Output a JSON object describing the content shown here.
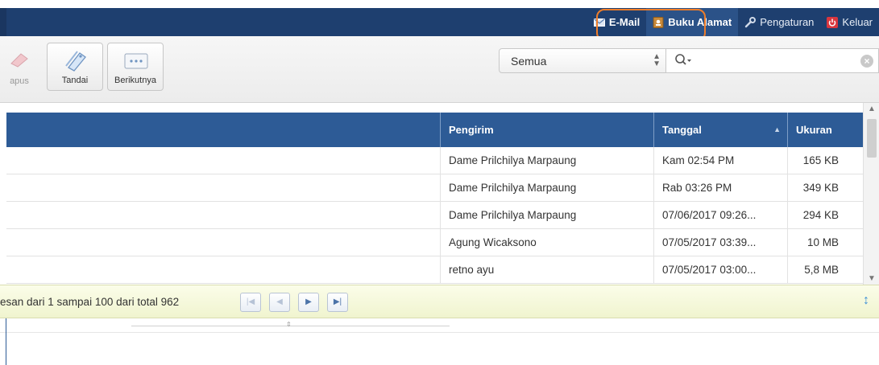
{
  "nav": {
    "email": "E-Mail",
    "address_book": "Buku Alamat",
    "settings": "Pengaturan",
    "logout": "Keluar"
  },
  "toolbar": {
    "delete_label": "apus",
    "mark_label": "Tandai",
    "more_label": "Berikutnya"
  },
  "filter": {
    "selected": "Semua",
    "search_value": ""
  },
  "table": {
    "columns": {
      "sender": "Pengirim",
      "date": "Tanggal",
      "size": "Ukuran"
    },
    "rows": [
      {
        "sender": "Dame Prilchilya Marpaung",
        "date": "Kam 02:54 PM",
        "size": "165 KB"
      },
      {
        "sender": "Dame Prilchilya Marpaung",
        "date": "Rab 03:26 PM",
        "size": "349 KB"
      },
      {
        "sender": "Dame Prilchilya Marpaung",
        "date": "07/06/2017 09:26...",
        "size": "294 KB"
      },
      {
        "sender": "Agung Wicaksono",
        "date": "07/05/2017 03:39...",
        "size": "10 MB"
      },
      {
        "sender": "retno ayu",
        "date": "07/05/2017 03:00...",
        "size": "5,8 MB"
      }
    ]
  },
  "pager": {
    "text": "esan dari 1 sampai 100 dari total 962"
  },
  "colors": {
    "nav_bg": "#1e3f6f",
    "header_bg": "#2d5b96",
    "highlight": "#ee7d2a",
    "pager_bg": "#f0f4cf"
  }
}
